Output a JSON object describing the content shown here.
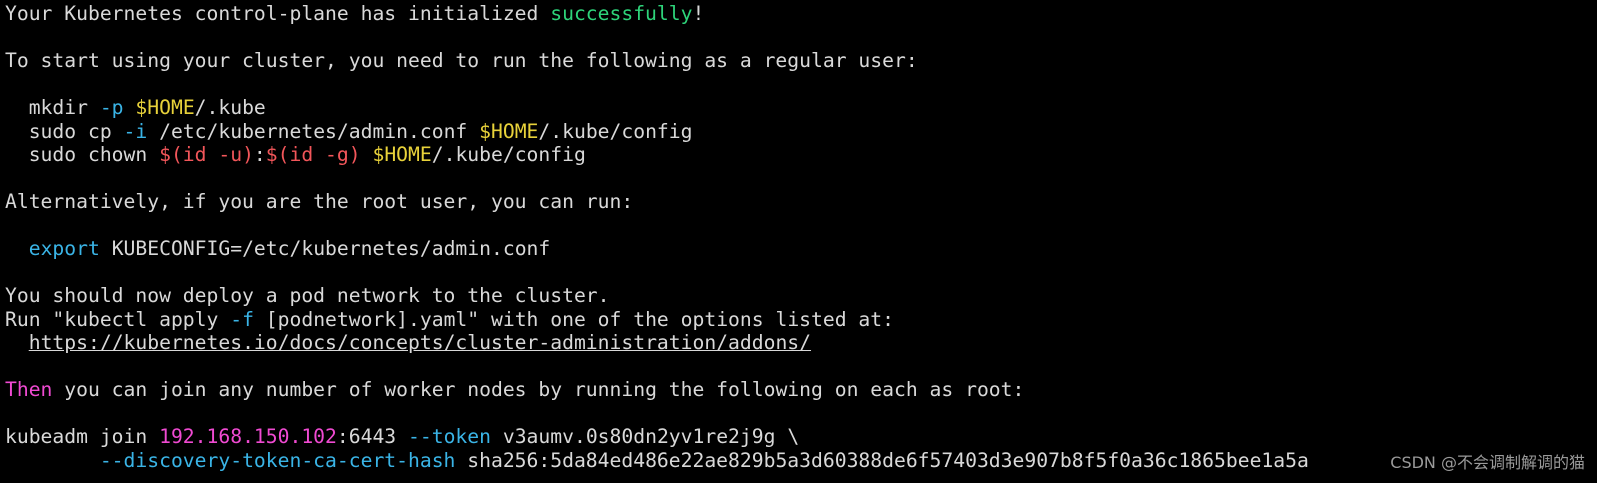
{
  "terminal": {
    "lines": [
      [
        {
          "text": "Your Kubernetes control-plane has initialized ",
          "color": ""
        },
        {
          "text": "successfully",
          "color": "green"
        },
        {
          "text": "!",
          "color": ""
        }
      ],
      [],
      [
        {
          "text": "To start using your cluster, you need to run the following as a regular user:",
          "color": ""
        }
      ],
      [],
      [
        {
          "text": "  mkdir ",
          "color": ""
        },
        {
          "text": "-p",
          "color": "blue"
        },
        {
          "text": " ",
          "color": ""
        },
        {
          "text": "$HOME",
          "color": "yellow"
        },
        {
          "text": "/.kube",
          "color": ""
        }
      ],
      [
        {
          "text": "  sudo cp ",
          "color": ""
        },
        {
          "text": "-i",
          "color": "blue"
        },
        {
          "text": " /etc/kubernetes/admin.conf ",
          "color": ""
        },
        {
          "text": "$HOME",
          "color": "yellow"
        },
        {
          "text": "/.kube/config",
          "color": ""
        }
      ],
      [
        {
          "text": "  sudo chown ",
          "color": ""
        },
        {
          "text": "$(id -u)",
          "color": "red"
        },
        {
          "text": ":",
          "color": ""
        },
        {
          "text": "$(id -g)",
          "color": "red"
        },
        {
          "text": " ",
          "color": ""
        },
        {
          "text": "$HOME",
          "color": "yellow"
        },
        {
          "text": "/.kube/config",
          "color": ""
        }
      ],
      [],
      [
        {
          "text": "Alternatively, if you are the root user, you can run:",
          "color": ""
        }
      ],
      [],
      [
        {
          "text": "  ",
          "color": ""
        },
        {
          "text": "export",
          "color": "blue"
        },
        {
          "text": " KUBECONFIG=/etc/kubernetes/admin.conf",
          "color": ""
        }
      ],
      [],
      [
        {
          "text": "You should now deploy a pod network to the cluster.",
          "color": ""
        }
      ],
      [
        {
          "text": "Run \"kubectl apply ",
          "color": ""
        },
        {
          "text": "-f",
          "color": "blue"
        },
        {
          "text": " [podnetwork].yaml\" with one of the options listed at:",
          "color": ""
        }
      ],
      [
        {
          "text": "  ",
          "color": ""
        },
        {
          "text": "https://kubernetes.io/docs/concepts/cluster-administration/addons/",
          "color": "link"
        }
      ],
      [],
      [
        {
          "text": "Then",
          "color": "magenta"
        },
        {
          "text": " you can join any number of worker nodes by running the following on each as root:",
          "color": ""
        }
      ],
      [],
      [
        {
          "text": "kubeadm join ",
          "color": ""
        },
        {
          "text": "192.168.150.102",
          "color": "magenta"
        },
        {
          "text": ":6443 ",
          "color": ""
        },
        {
          "text": "--token",
          "color": "blue"
        },
        {
          "text": " v3aumv.0s80dn2yv1re2j9g \\",
          "color": ""
        }
      ],
      [
        {
          "text": "        ",
          "color": ""
        },
        {
          "text": "--discovery-token-ca-cert-hash",
          "color": "blue"
        },
        {
          "text": " sha256:5da84ed486e22ae829b5a3d60388de6f57403d3e907b8f5f0a36c1865bee1a5a",
          "color": ""
        }
      ]
    ]
  },
  "watermark": "CSDN @不会调制解调的猫",
  "colors": {
    "background": "#000000",
    "text": "#d9d9d9",
    "green": "#2ed47a",
    "blue": "#3ab4e6",
    "yellow": "#e8d23a",
    "red": "#f2565a",
    "magenta": "#f04ad2"
  }
}
